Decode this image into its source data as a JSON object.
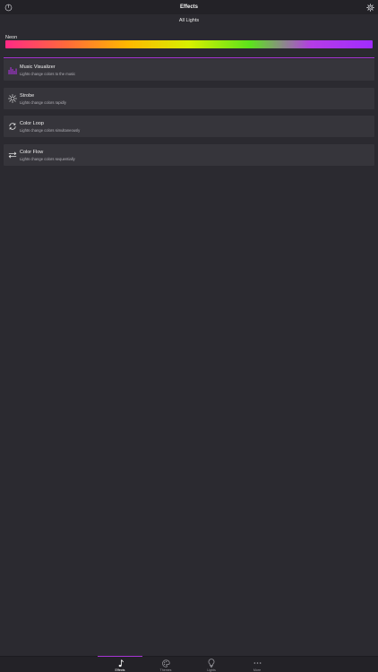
{
  "nav": {
    "title": "Effects",
    "subtitle": "All Lights"
  },
  "palette": {
    "label": "Neon",
    "gradient_colors": [
      "#ff2a85",
      "#ff6a3a",
      "#ffb800",
      "#d8f000",
      "#5ce31c",
      "#b43ce6",
      "#a12cff"
    ]
  },
  "accent_color": "#a834d6",
  "effects": [
    {
      "name": "Music Visualizer",
      "description": "Lights change colors to the music",
      "icon": "equalizer-icon",
      "selected": true
    },
    {
      "name": "Strobe",
      "description": "Lights change colors rapidly",
      "icon": "sun-icon",
      "selected": false
    },
    {
      "name": "Color Loop",
      "description": "Lights change colors simultaneously",
      "icon": "loop-icon",
      "selected": false
    },
    {
      "name": "Color Flow",
      "description": "Lights change colors sequentially",
      "icon": "flow-arrows-icon",
      "selected": false
    }
  ],
  "tabs": [
    {
      "label": "Effects",
      "icon": "music-note-icon",
      "active": true
    },
    {
      "label": "Themes",
      "icon": "palette-icon",
      "active": false
    },
    {
      "label": "Lights",
      "icon": "bulb-icon",
      "active": false
    },
    {
      "label": "More",
      "icon": "more-dots-icon",
      "active": false
    }
  ]
}
